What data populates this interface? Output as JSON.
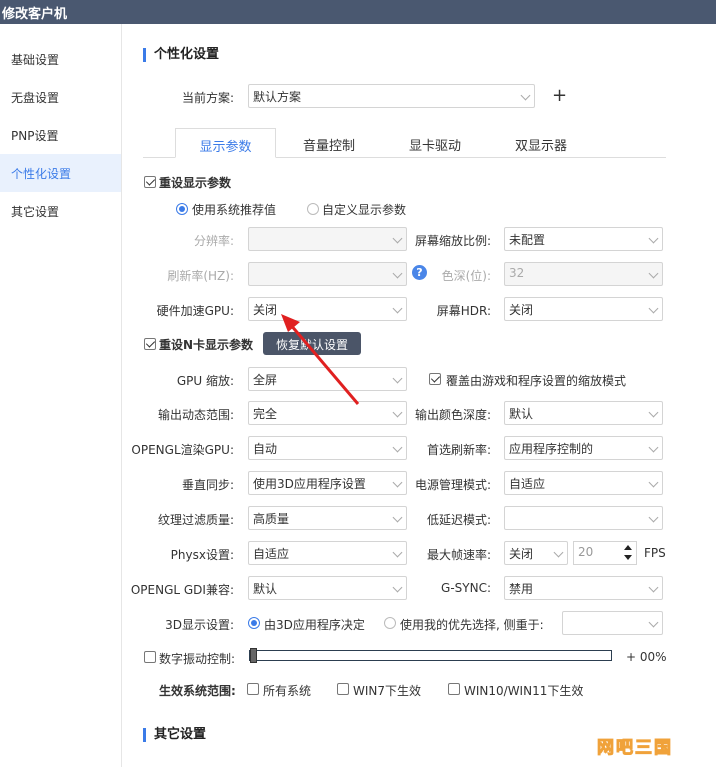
{
  "window": {
    "title": "修改客户机"
  },
  "sidebar": {
    "items": [
      {
        "label": "基础设置"
      },
      {
        "label": "无盘设置"
      },
      {
        "label": "PNP设置"
      },
      {
        "label": "个性化设置"
      },
      {
        "label": "其它设置"
      }
    ]
  },
  "personal": {
    "title": "个性化设置",
    "scheme_label": "当前方案:",
    "scheme_value": "默认方案",
    "add_symbol": "+"
  },
  "tabs": [
    {
      "label": "显示参数"
    },
    {
      "label": "音量控制"
    },
    {
      "label": "显卡驱动"
    },
    {
      "label": "双显示器"
    }
  ],
  "display": {
    "reset_label": "重设显示参数",
    "radio_system": "使用系统推荐值",
    "radio_custom": "自定义显示参数",
    "resolution_label": "分辨率:",
    "resolution_value": "",
    "scale_label": "屏幕缩放比例:",
    "scale_value": "未配置",
    "refresh_label": "刷新率(HZ):",
    "refresh_value": "",
    "help_symbol": "?",
    "color_depth_label": "色深(位):",
    "color_depth_value": "32",
    "hw_gpu_label": "硬件加速GPU:",
    "hw_gpu_value": "关闭",
    "hdr_label": "屏幕HDR:",
    "hdr_value": "关闭"
  },
  "nvidia": {
    "reset_label": "重设N卡显示参数",
    "tooltip": "恢复默认设置",
    "gpu_scale_label": "GPU 缩放:",
    "gpu_scale_value": "全屏",
    "override_label": "覆盖由游戏和程序设置的缩放模式",
    "output_range_label": "输出动态范围:",
    "output_range_value": "完全",
    "output_depth_label": "输出颜色深度:",
    "output_depth_value": "默认",
    "opengl_gpu_label": "OPENGL渲染GPU:",
    "opengl_gpu_value": "自动",
    "pref_refresh_label": "首选刷新率:",
    "pref_refresh_value": "应用程序控制的",
    "vsync_label": "垂直同步:",
    "vsync_value": "使用3D应用程序设置",
    "power_label": "电源管理模式:",
    "power_value": "自适应",
    "texture_label": "纹理过滤质量:",
    "texture_value": "高质量",
    "low_latency_label": "低延迟模式:",
    "low_latency_value": "",
    "physx_label": "Physx设置:",
    "physx_value": "自适应",
    "max_fps_label": "最大帧速率:",
    "max_fps_value": "关闭",
    "max_fps_num": "20",
    "fps_unit": "FPS",
    "gdi_label": "OPENGL GDI兼容:",
    "gdi_value": "默认",
    "gsync_label": "G-SYNC:",
    "gsync_value": "禁用",
    "d3_label": "3D显示设置:",
    "d3_radio_app": "由3D应用程序决定",
    "d3_radio_pref": "使用我的优先选择, 侧重于:",
    "d3_pref_value": "",
    "vibrance_label": "数字振动控制:",
    "vibrance_value": "+ 00%",
    "vibrance_fraction": 0,
    "scope_label": "生效系统范围:",
    "scope_all": "所有系统",
    "scope_win7": "WIN7下生效",
    "scope_win10": "WIN10/WIN11下生效"
  },
  "other": {
    "title": "其它设置"
  },
  "watermark": "网吧三国"
}
